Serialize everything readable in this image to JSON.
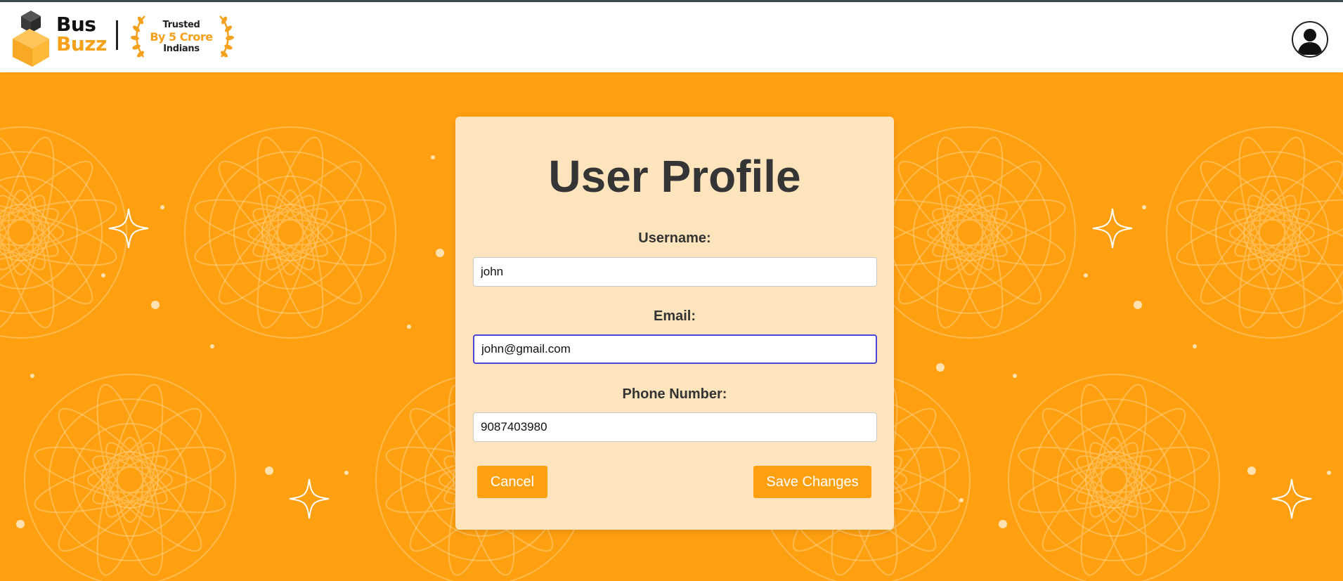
{
  "header": {
    "brand_line1": "Bus",
    "brand_line2": "Buzz",
    "trust_line1": "Trusted",
    "trust_line2": "By 5 Crore",
    "trust_line3": "Indians",
    "avatar_icon": "user-avatar-icon"
  },
  "colors": {
    "accent": "#ffa010",
    "card": "#fee4bd",
    "focus_border": "#4b44d8"
  },
  "profile": {
    "title": "User Profile",
    "username_label": "Username:",
    "username_value": "john",
    "email_label": "Email:",
    "email_value": "john@gmail.com",
    "phone_label": "Phone Number:",
    "phone_value": "9087403980",
    "cancel_label": "Cancel",
    "save_label": "Save Changes"
  }
}
